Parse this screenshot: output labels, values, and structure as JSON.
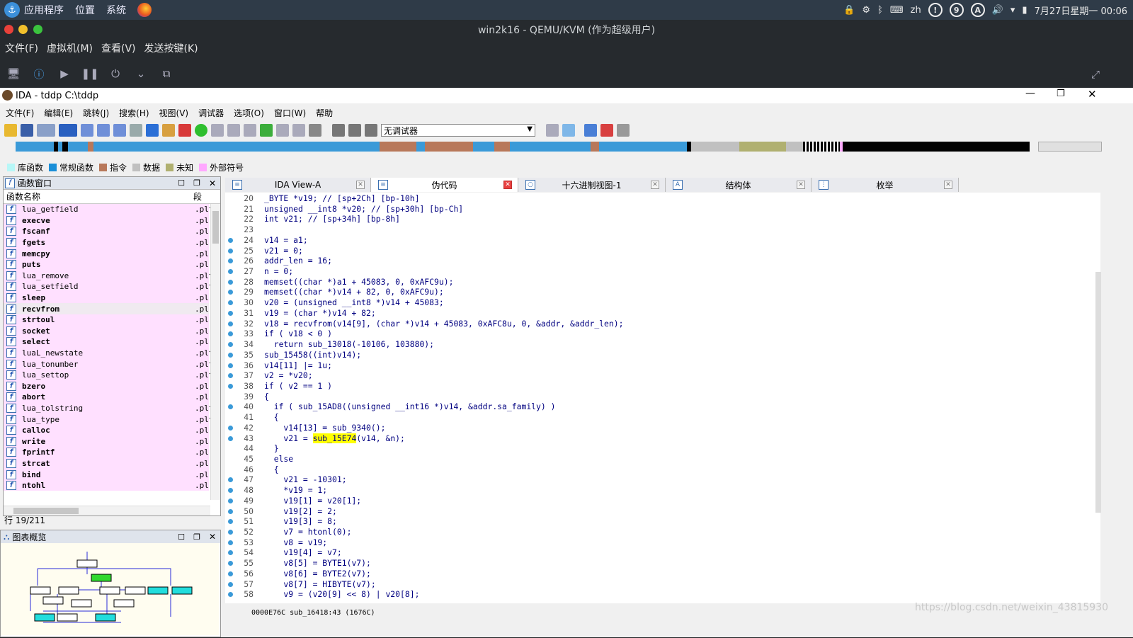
{
  "sysbar": {
    "menus": [
      "应用程序",
      "位置",
      "系统"
    ],
    "clock": "7月27日星期一 00:06",
    "lang": "zh",
    "badge": "9",
    "a_label": "A"
  },
  "qemu": {
    "title": "win2k16 - QEMU/KVM (作为超级用户)",
    "menus": [
      "文件(F)",
      "虚拟机(M)",
      "查看(V)",
      "发送按键(K)"
    ]
  },
  "ida": {
    "title": "IDA - tddp C:\\tddp",
    "menus": [
      "文件(F)",
      "编辑(E)",
      "跳转(J)",
      "搜索(H)",
      "视图(V)",
      "调试器",
      "选项(O)",
      "窗口(W)",
      "帮助"
    ],
    "debugger_select": "无调试器",
    "legend": [
      {
        "label": "库函数",
        "color": "#b7f7f7"
      },
      {
        "label": "常规函数",
        "color": "#1a8fd8"
      },
      {
        "label": "指令",
        "color": "#b8785a"
      },
      {
        "label": "数据",
        "color": "#c0c0c0"
      },
      {
        "label": "未知",
        "color": "#b0b070"
      },
      {
        "label": "外部符号",
        "color": "#ffa8ff"
      }
    ],
    "func_window": {
      "title": "函数窗口",
      "col_name": "函数名称",
      "col_seg": "段",
      "row_status": "行 19/211"
    },
    "functions": [
      {
        "name": "lua_getfield",
        "seg": ".plt"
      },
      {
        "name": "execve",
        "seg": ".pl"
      },
      {
        "name": "fscanf",
        "seg": ".pl"
      },
      {
        "name": "fgets",
        "seg": ".pl"
      },
      {
        "name": "memcpy",
        "seg": ".pl"
      },
      {
        "name": "puts",
        "seg": ".pl"
      },
      {
        "name": "lua_remove",
        "seg": ".plt"
      },
      {
        "name": "lua_setfield",
        "seg": ".plt"
      },
      {
        "name": "sleep",
        "seg": ".pl"
      },
      {
        "name": "recvfrom",
        "seg": ".pl"
      },
      {
        "name": "strtoul",
        "seg": ".pl"
      },
      {
        "name": "socket",
        "seg": ".pl"
      },
      {
        "name": "select",
        "seg": ".pl"
      },
      {
        "name": "luaL_newstate",
        "seg": ".plt"
      },
      {
        "name": "lua_tonumber",
        "seg": ".plt"
      },
      {
        "name": "lua_settop",
        "seg": ".plt"
      },
      {
        "name": "bzero",
        "seg": ".pl"
      },
      {
        "name": "abort",
        "seg": ".pl"
      },
      {
        "name": "lua_tolstring",
        "seg": ".plt"
      },
      {
        "name": "lua_type",
        "seg": ".plt"
      },
      {
        "name": "calloc",
        "seg": ".pl"
      },
      {
        "name": "write",
        "seg": ".pl"
      },
      {
        "name": "fprintf",
        "seg": ".pl"
      },
      {
        "name": "strcat",
        "seg": ".pl"
      },
      {
        "name": "bind",
        "seg": ".pl"
      },
      {
        "name": "ntohl",
        "seg": ".pl"
      }
    ],
    "graph_window": {
      "title": "图表概览"
    },
    "tabs": [
      {
        "label": "IDA View-A"
      },
      {
        "label": "伪代码"
      },
      {
        "label": "十六进制视图-1"
      },
      {
        "label": "结构体"
      },
      {
        "label": "枚举"
      }
    ],
    "code_lines": [
      {
        "n": "20",
        "bp": false,
        "t": "_BYTE *v19; // [sp+2Ch] [bp-10h]"
      },
      {
        "n": "21",
        "bp": false,
        "t": "unsigned __int8 *v20; // [sp+30h] [bp-Ch]"
      },
      {
        "n": "22",
        "bp": false,
        "t": "int v21; // [sp+34h] [bp-8h]"
      },
      {
        "n": "23",
        "bp": false,
        "t": ""
      },
      {
        "n": "24",
        "bp": true,
        "t": "v14 = a1;"
      },
      {
        "n": "25",
        "bp": true,
        "t": "v21 = 0;"
      },
      {
        "n": "26",
        "bp": true,
        "t": "addr_len = 16;"
      },
      {
        "n": "27",
        "bp": true,
        "t": "n = 0;"
      },
      {
        "n": "28",
        "bp": true,
        "t": "memset((char *)a1 + 45083, 0, 0xAFC9u);"
      },
      {
        "n": "29",
        "bp": true,
        "t": "memset((char *)v14 + 82, 0, 0xAFC9u);"
      },
      {
        "n": "30",
        "bp": true,
        "t": "v20 = (unsigned __int8 *)v14 + 45083;"
      },
      {
        "n": "31",
        "bp": true,
        "t": "v19 = (char *)v14 + 82;"
      },
      {
        "n": "32",
        "bp": true,
        "t": "v18 = recvfrom(v14[9], (char *)v14 + 45083, 0xAFC8u, 0, &addr, &addr_len);"
      },
      {
        "n": "33",
        "bp": true,
        "t": "if ( v18 < 0 )"
      },
      {
        "n": "34",
        "bp": true,
        "t": "  return sub_13018(-10106, 103880);"
      },
      {
        "n": "35",
        "bp": true,
        "t": "sub_15458((int)v14);"
      },
      {
        "n": "36",
        "bp": true,
        "t": "v14[11] |= 1u;"
      },
      {
        "n": "37",
        "bp": true,
        "t": "v2 = *v20;"
      },
      {
        "n": "38",
        "bp": true,
        "t": "if ( v2 == 1 )"
      },
      {
        "n": "39",
        "bp": false,
        "t": "{"
      },
      {
        "n": "40",
        "bp": true,
        "t": "  if ( sub_15AD8((unsigned __int16 *)v14, &addr.sa_family) )"
      },
      {
        "n": "41",
        "bp": false,
        "t": "  {"
      },
      {
        "n": "42",
        "bp": true,
        "t": "    v14[13] = sub_9340();"
      },
      {
        "n": "43",
        "bp": true,
        "t": "    v21 = sub_15E74(v14, &n);"
      },
      {
        "n": "44",
        "bp": false,
        "t": "  }"
      },
      {
        "n": "45",
        "bp": false,
        "t": "  else"
      },
      {
        "n": "46",
        "bp": false,
        "t": "  {"
      },
      {
        "n": "47",
        "bp": true,
        "t": "    v21 = -10301;"
      },
      {
        "n": "48",
        "bp": true,
        "t": "    *v19 = 1;"
      },
      {
        "n": "49",
        "bp": true,
        "t": "    v19[1] = v20[1];"
      },
      {
        "n": "50",
        "bp": true,
        "t": "    v19[2] = 2;"
      },
      {
        "n": "51",
        "bp": true,
        "t": "    v19[3] = 8;"
      },
      {
        "n": "52",
        "bp": true,
        "t": "    v7 = htonl(0);"
      },
      {
        "n": "53",
        "bp": true,
        "t": "    v8 = v19;"
      },
      {
        "n": "54",
        "bp": true,
        "t": "    v19[4] = v7;"
      },
      {
        "n": "55",
        "bp": true,
        "t": "    v8[5] = BYTE1(v7);"
      },
      {
        "n": "56",
        "bp": true,
        "t": "    v8[6] = BYTE2(v7);"
      },
      {
        "n": "57",
        "bp": true,
        "t": "    v8[7] = HIBYTE(v7);"
      },
      {
        "n": "58",
        "bp": true,
        "t": "    v9 = (v20[9] << 8) | v20[8];"
      }
    ],
    "status": {
      "addr": "0000E76C",
      "loc": "sub_16418:43",
      "off": "(1676C)"
    }
  },
  "watermark": "https://blog.csdn.net/weixin_43815930"
}
